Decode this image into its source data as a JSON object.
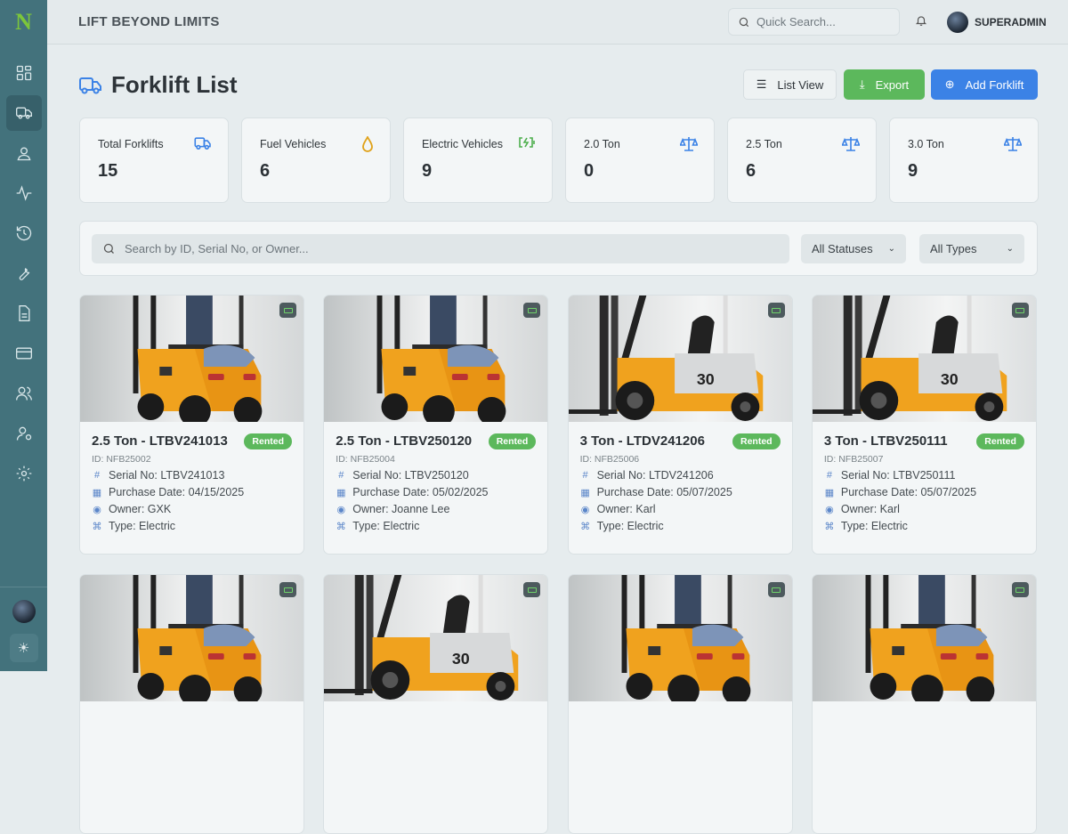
{
  "app": {
    "logo": "N",
    "brand": "LIFT BEYOND LIMITS",
    "search_placeholder": "Quick Search...",
    "user": "SUPERADMIN"
  },
  "sidebar": {
    "items": [
      "dashboard",
      "forklifts",
      "customers",
      "activity",
      "history",
      "maintenance",
      "documents",
      "billing",
      "users",
      "user-settings",
      "settings"
    ],
    "active": "forklifts"
  },
  "page": {
    "title": "Forklift List",
    "list_view": "List View",
    "export": "Export",
    "add": "Add Forklift"
  },
  "colors": {
    "sidebar": "#43727c",
    "export": "#5cb85c",
    "add": "#3b82e6",
    "rented": "#5cb85c"
  },
  "stats": [
    {
      "label": "Total Forklifts",
      "value": "15",
      "icon": "truck-icon"
    },
    {
      "label": "Fuel Vehicles",
      "value": "6",
      "icon": "fuel-drop-icon"
    },
    {
      "label": "Electric Vehicles",
      "value": "9",
      "icon": "battery-charging-icon"
    },
    {
      "label": "2.0 Ton",
      "value": "0",
      "icon": "scale-icon"
    },
    {
      "label": "2.5 Ton",
      "value": "6",
      "icon": "scale-icon"
    },
    {
      "label": "3.0 Ton",
      "value": "9",
      "icon": "scale-icon"
    }
  ],
  "filters": {
    "search_placeholder": "Search by ID, Serial No, or Owner...",
    "status": "All Statuses",
    "type": "All Types"
  },
  "forklifts": [
    {
      "name": "2.5 Ton - LTBV241013",
      "status": "Rented",
      "id": "ID: NFB25002",
      "serial": "Serial No: LTBV241013",
      "date": "Purchase Date: 04/15/2025",
      "owner": "Owner: GXK",
      "type": "Type: Electric",
      "view": "rear"
    },
    {
      "name": "2.5 Ton - LTBV250120",
      "status": "Rented",
      "id": "ID: NFB25004",
      "serial": "Serial No: LTBV250120",
      "date": "Purchase Date: 05/02/2025",
      "owner": "Owner: Joanne Lee",
      "type": "Type: Electric",
      "view": "rear"
    },
    {
      "name": "3 Ton - LTDV241206",
      "status": "Rented",
      "id": "ID: NFB25006",
      "serial": "Serial No: LTDV241206",
      "date": "Purchase Date: 05/07/2025",
      "owner": "Owner: Karl",
      "type": "Type: Electric",
      "view": "side"
    },
    {
      "name": "3 Ton - LTBV250111",
      "status": "Rented",
      "id": "ID: NFB25007",
      "serial": "Serial No: LTBV250111",
      "date": "Purchase Date: 05/07/2025",
      "owner": "Owner: Karl",
      "type": "Type: Electric",
      "view": "side"
    },
    {
      "view": "rear"
    },
    {
      "view": "side"
    },
    {
      "view": "rear"
    },
    {
      "view": "rear"
    }
  ]
}
